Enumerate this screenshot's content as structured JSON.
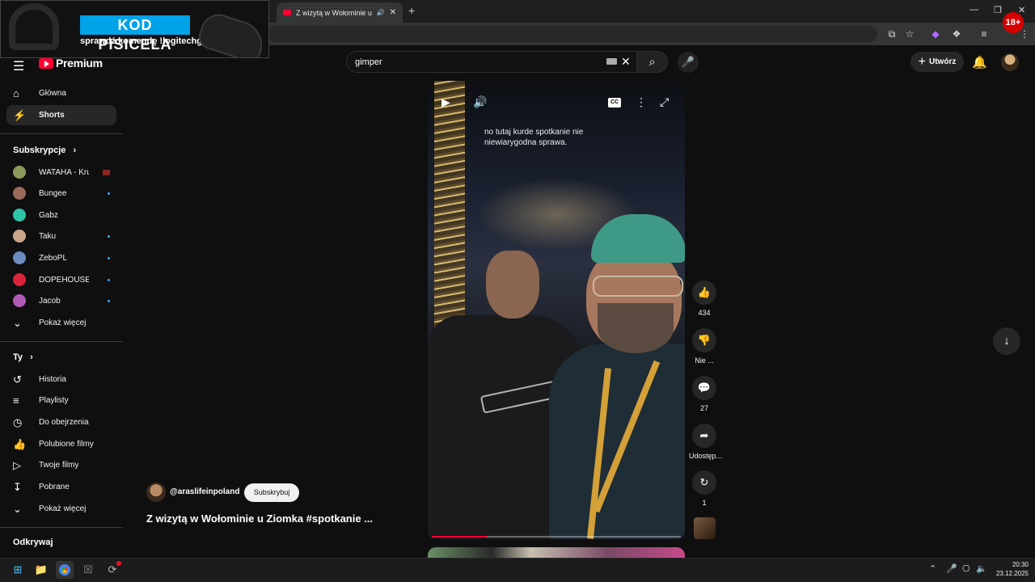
{
  "browser": {
    "tab_title": "Z wizytą w Wołominie u Zio",
    "new_tab_icon": "plus-icon",
    "window_controls": [
      "minimize-icon",
      "restore-icon",
      "close-icon"
    ]
  },
  "ad_overlay": {
    "badge": "KOD PISICELA",
    "subtitle": "sprawdź komendę !logitechg",
    "age_badge": "18+"
  },
  "header": {
    "logo_text": "Premium",
    "search_value": "gimper",
    "create_label": "Utwórz"
  },
  "sidebar": {
    "main": [
      {
        "label": "Główna",
        "icon": "home-icon"
      },
      {
        "label": "Shorts",
        "icon": "shorts-icon",
        "active": true
      }
    ],
    "subs_title": "Subskrypcje",
    "subscriptions": [
      {
        "label": "WATAHA - Krule...",
        "color": "#8a9a5b",
        "status": "live"
      },
      {
        "label": "Bungee",
        "color": "#9a6a5a",
        "status": "new"
      },
      {
        "label": "Gabz",
        "color": "#2ec4a6",
        "status": ""
      },
      {
        "label": "Taku",
        "color": "#c9a58a",
        "status": "new"
      },
      {
        "label": "ZeboPL",
        "color": "#6b8cbf",
        "status": "new"
      },
      {
        "label": "DOPEHOUSE RE...",
        "color": "#d6243a",
        "status": "new"
      },
      {
        "label": "Jacob",
        "color": "#b05ab8",
        "status": "new"
      }
    ],
    "subs_more": "Pokaż więcej",
    "you_title": "Ty",
    "you_items": [
      {
        "label": "Historia",
        "icon": "history-icon"
      },
      {
        "label": "Playlisty",
        "icon": "playlist-icon"
      },
      {
        "label": "Do obejrzenia",
        "icon": "watch-later-icon"
      },
      {
        "label": "Polubione filmy",
        "icon": "like-icon"
      },
      {
        "label": "Twoje filmy",
        "icon": "your-videos-icon"
      },
      {
        "label": "Pobrane",
        "icon": "download-icon"
      },
      {
        "label": "Pokaż więcej",
        "icon": "chevron-down-icon"
      }
    ],
    "explore_title": "Odkrywaj"
  },
  "short": {
    "caption": "no tutaj kurde spotkanie nie niewiarygodna sprawa.",
    "channel": "@araslifeinpoland",
    "subscribe_label": "Subskrybuj",
    "title": "Z wizytą w Wołominie u Ziomka #spotkanie  ...",
    "cc_label": "CC",
    "progress": 0.22,
    "actions": {
      "likes": "434",
      "dislike": "Nie ...",
      "comments": "27",
      "share": "Udostęp...",
      "remix": "1"
    }
  },
  "taskbar": {
    "time": "20:30",
    "date": "23.12.2025"
  }
}
